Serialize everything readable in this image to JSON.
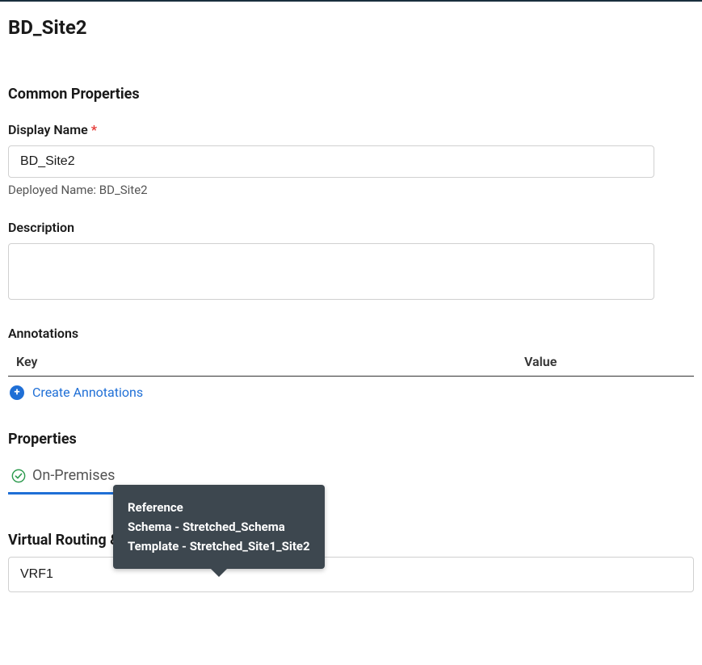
{
  "page_title": "BD_Site2",
  "common_properties": {
    "heading": "Common Properties",
    "display_name": {
      "label": "Display Name",
      "value": "BD_Site2",
      "helper_prefix": "Deployed Name: ",
      "deployed_name": "BD_Site2"
    },
    "description": {
      "label": "Description",
      "value": ""
    },
    "annotations": {
      "label": "Annotations",
      "col_key": "Key",
      "col_value": "Value",
      "create_link": "Create Annotations"
    }
  },
  "properties": {
    "heading": "Properties",
    "tabs": {
      "on_premises": "On-Premises"
    }
  },
  "tooltip": {
    "title": "Reference",
    "line1": "Schema - Stretched_Schema",
    "line2": "Template - Stretched_Site1_Site2"
  },
  "vrf": {
    "label": "Virtual Routing & Forwarding",
    "value": "VRF1"
  }
}
